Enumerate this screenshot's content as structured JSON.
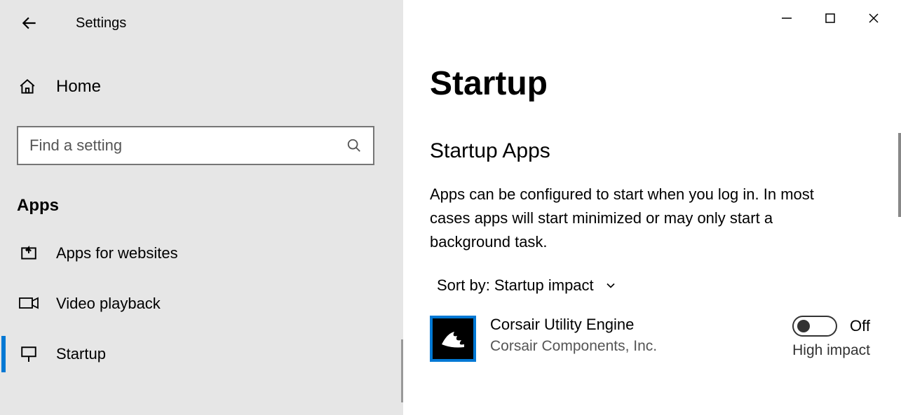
{
  "header": {
    "title": "Settings"
  },
  "sidebar": {
    "home_label": "Home",
    "search_placeholder": "Find a setting",
    "section_label": "Apps",
    "items": [
      {
        "key": "apps-for-websites",
        "label": "Apps for websites"
      },
      {
        "key": "video-playback",
        "label": "Video playback"
      },
      {
        "key": "startup",
        "label": "Startup"
      }
    ]
  },
  "main": {
    "title": "Startup",
    "subheading": "Startup Apps",
    "description": "Apps can be configured to start when you log in. In most cases apps will start minimized or may only start a background task.",
    "sort_label": "Sort by:",
    "sort_value": "Startup impact",
    "apps": [
      {
        "name": "Corsair Utility Engine",
        "publisher": "Corsair Components, Inc.",
        "toggle_state": "Off",
        "impact": "High impact"
      }
    ]
  }
}
